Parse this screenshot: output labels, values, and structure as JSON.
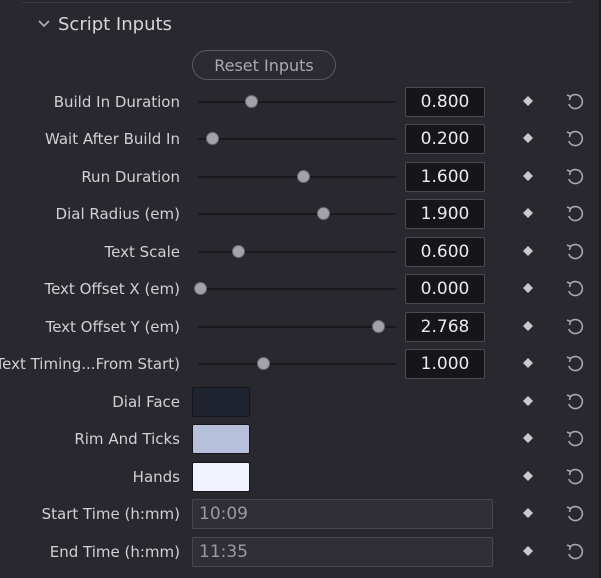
{
  "section": {
    "title": "Script Inputs",
    "icon": "chevron-down-icon"
  },
  "reset_button": {
    "label": "Reset Inputs"
  },
  "sliders": [
    {
      "label": "Build In Duration",
      "value": "0.800",
      "position": 0.27
    },
    {
      "label": "Wait After Build In",
      "value": "0.200",
      "position": 0.07
    },
    {
      "label": "Run Duration",
      "value": "1.600",
      "position": 0.53
    },
    {
      "label": "Dial Radius (em)",
      "value": "1.900",
      "position": 0.63
    },
    {
      "label": "Text Scale",
      "value": "0.600",
      "position": 0.2
    },
    {
      "label": "Text Offset X (em)",
      "value": "0.000",
      "position": 0.01
    },
    {
      "label": "Text Offset Y (em)",
      "value": "2.768",
      "position": 0.91
    },
    {
      "label": "Text Timing...From Start)",
      "value": "1.000",
      "position": 0.33
    }
  ],
  "colors": [
    {
      "label": "Dial Face",
      "color": "#1f2430"
    },
    {
      "label": "Rim And Ticks",
      "color": "#b7c0da"
    },
    {
      "label": "Hands",
      "color": "#f0f2ff"
    }
  ],
  "texts": [
    {
      "label": "Start Time (h:mm)",
      "value": "10:09"
    },
    {
      "label": "End Time (h:mm)",
      "value": "11:35"
    }
  ],
  "row_icons": {
    "keyframe": "diamond-keyframe-icon",
    "reset": "reset-icon"
  }
}
